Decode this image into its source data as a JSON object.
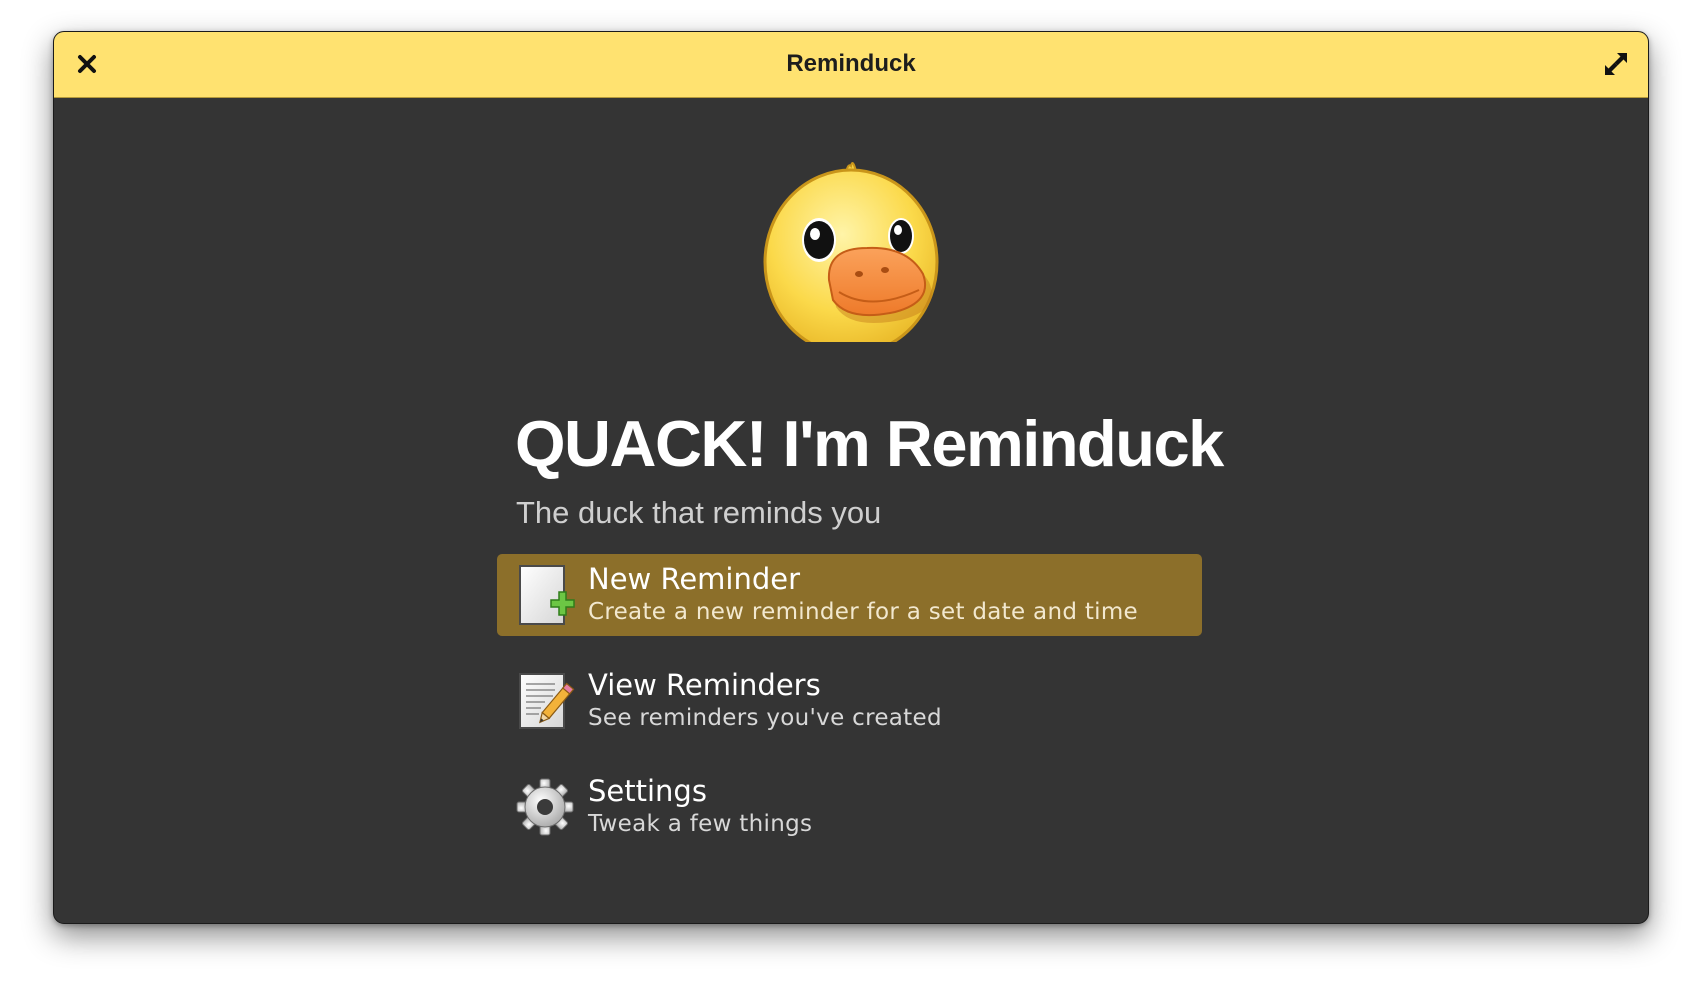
{
  "window": {
    "title": "Reminduck"
  },
  "titlebar": {
    "close_icon": "close-icon",
    "maximize_icon": "maximize-icon",
    "color": "#ffe270"
  },
  "main": {
    "logo_icon": "duck-icon",
    "heading": "QUACK! I'm Reminduck",
    "subtitle": "The duck that reminds you",
    "menu": [
      {
        "label": "New Reminder",
        "description": "Create a new reminder for a set date and time",
        "icon": "new-document-icon",
        "selected": true
      },
      {
        "label": "View Reminders",
        "description": "See reminders you've created",
        "icon": "edit-document-icon",
        "selected": false
      },
      {
        "label": "Settings",
        "description": "Tweak a few things",
        "icon": "gear-icon",
        "selected": false
      }
    ]
  },
  "colors": {
    "background": "#343434",
    "accent_selected": "#8c6f2a",
    "text_primary": "#ffffff",
    "text_secondary": "#cfcfcf"
  }
}
